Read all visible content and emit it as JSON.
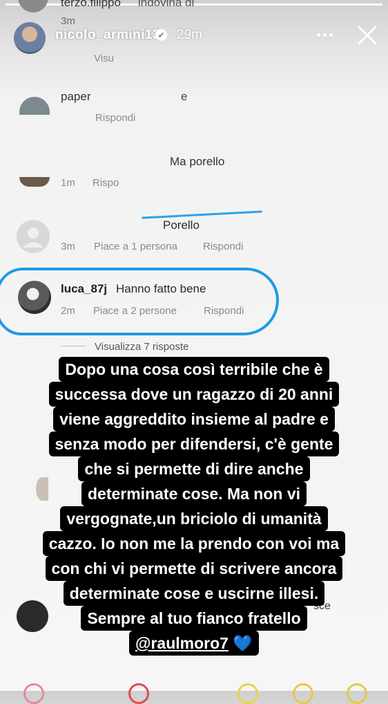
{
  "story": {
    "username": "nicolo_armini13",
    "verified_icon": "✔",
    "time": "29m"
  },
  "icons": {
    "more": "more-icon",
    "close": "close-icon",
    "verified": "verified-badge-icon"
  },
  "colors": {
    "highlight": "#1e9ae6",
    "overlay_bg": "#000000",
    "overlay_text": "#ffffff",
    "heart": "#1e6fd9"
  },
  "comments": [
    {
      "username": "terzo.filippo",
      "text": "indovina di",
      "time": "3m"
    },
    {
      "username": "",
      "text": "Visu",
      "time": ""
    },
    {
      "username": "paper",
      "text": "e",
      "reply": "Rispondi"
    },
    {
      "username": "",
      "text": "Ma porello",
      "time": "1m",
      "reply": "Rispo"
    },
    {
      "username": "",
      "text": "Porello",
      "time": "3m",
      "likes": "Piace a 1 persona",
      "reply": "Rispondi"
    },
    {
      "username": "luca_87j",
      "text": "Hanno fatto bene",
      "time": "2m",
      "likes": "Piace a 2 persone",
      "reply": "Rispondi"
    }
  ],
  "view_replies": "Visualizza 7 risposte",
  "partial_sce": "sce",
  "overlay_lines": [
    "Dopo una cosa così terribile che è",
    "successa dove un ragazzo di 20 anni",
    "viene aggreddito insieme al padre e",
    "senza modo per difendersi, c'è gente",
    "che si permette di dire anche",
    "determinate cose. Ma non vi",
    "vergognate,un briciolo di umanità",
    "cazzo. Io non me la prendo con voi ma",
    "con chi vi permette di scrivere ancora",
    "determinate cose e uscirne illesi.",
    "Sempre al tuo fianco fratello"
  ],
  "mention": "@raulmoro7",
  "heart": "💙"
}
